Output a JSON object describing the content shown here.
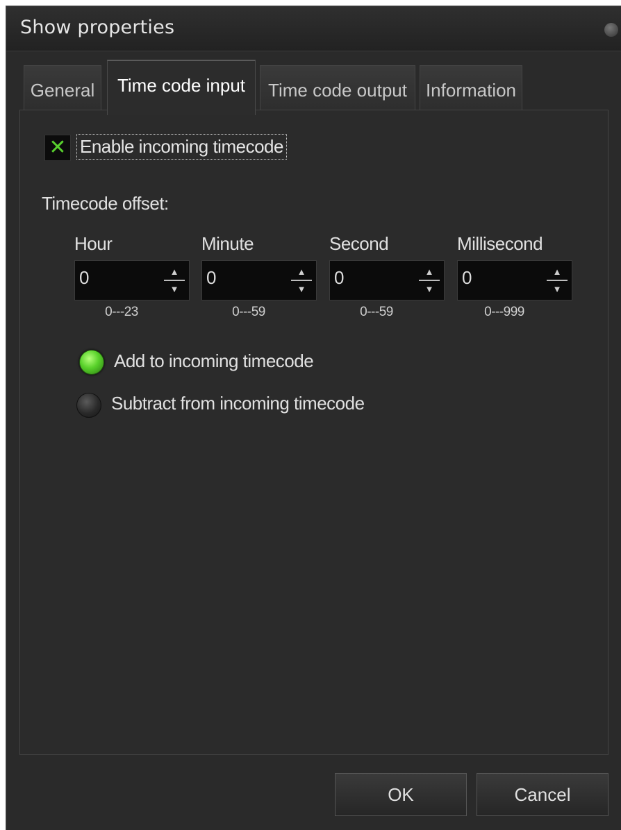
{
  "window": {
    "title": "Show properties"
  },
  "tabs": [
    {
      "label": "General",
      "active": false
    },
    {
      "label": "Time code input",
      "active": true
    },
    {
      "label": "Time code output",
      "active": false
    },
    {
      "label": "Information",
      "active": false
    }
  ],
  "enable_timecode": {
    "label": "Enable incoming timecode",
    "checked": true
  },
  "offset": {
    "label": "Timecode offset:",
    "fields": [
      {
        "label": "Hour",
        "value": "0",
        "range": "0---23"
      },
      {
        "label": "Minute",
        "value": "0",
        "range": "0---59"
      },
      {
        "label": "Second",
        "value": "0",
        "range": "0---59"
      },
      {
        "label": "Millisecond",
        "value": "0",
        "range": "0---999"
      }
    ]
  },
  "mode": {
    "options": [
      {
        "label": "Add to incoming timecode",
        "selected": true
      },
      {
        "label": "Subtract from incoming timecode",
        "selected": false
      }
    ]
  },
  "buttons": {
    "ok": "OK",
    "cancel": "Cancel"
  },
  "colors": {
    "background": "#2a2a2a",
    "accent_green": "#58d12a",
    "field_bg": "#0b0b0b"
  },
  "icons": {
    "checkbox_mark": "x-check-icon",
    "spin_up": "arrow-up-icon",
    "spin_down": "arrow-down-icon"
  }
}
